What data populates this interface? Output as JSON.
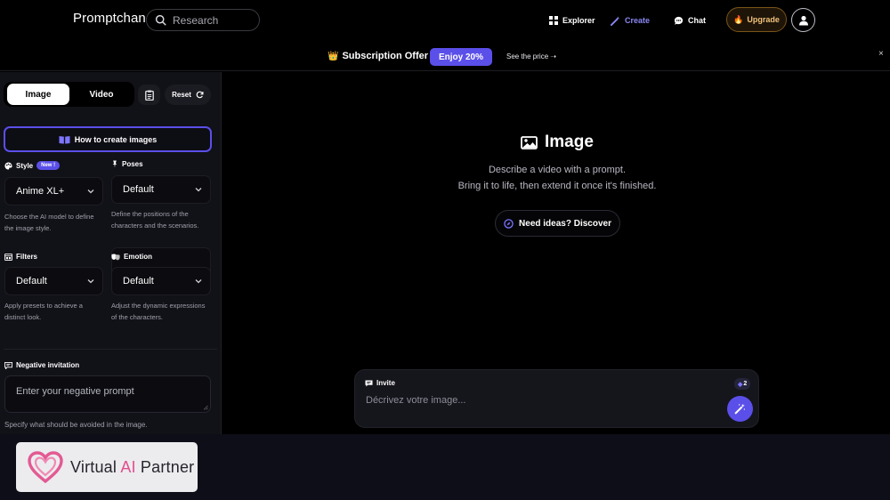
{
  "app": {
    "logo": "Promptchan"
  },
  "search": {
    "placeholder": "Research"
  },
  "nav": {
    "explorer": "Explorer",
    "create": "Create",
    "chat": "Chat",
    "upgrade": "Upgrade"
  },
  "offer": {
    "title": "Subscription Offer",
    "button": "Enjoy 20%",
    "link": "See the price ➝",
    "close": "×"
  },
  "sidebar": {
    "tabs": [
      "Image",
      "Video"
    ],
    "reset": "Reset",
    "howto": "How to create images",
    "style": {
      "label": "Style",
      "badge": "New !",
      "value": "Anime XL+",
      "help": "Choose the AI model to define the image style."
    },
    "poses": {
      "label": "Poses",
      "value": "Default",
      "help": "Define the positions of the characters and the scenarios."
    },
    "filters": {
      "label": "Filters",
      "value": "Default",
      "help": "Apply presets to achieve a distinct look."
    },
    "emotion": {
      "label": "Emotion",
      "value": "Default",
      "help": "Adjust the dynamic expressions of the characters."
    },
    "negative": {
      "label": "Negative invitation",
      "placeholder": "Enter your negative prompt",
      "help": "Specify what should be avoided in the image."
    }
  },
  "main": {
    "title": "Image",
    "line1": "Describe a video with a prompt.",
    "line2": "Bring it to life, then extend it once it's finished.",
    "ideas": "Need ideas? Discover",
    "prompt": {
      "label": "Invite",
      "placeholder": "Décrivez votre image...",
      "count": "2"
    }
  },
  "watermark": {
    "text_pre": "Virtual ",
    "text_ai": "AI",
    "text_post": " Partner"
  },
  "colors": {
    "accent": "#5b4fe9",
    "create_link": "#8b88f5",
    "upgrade_text": "#f2c27c"
  }
}
